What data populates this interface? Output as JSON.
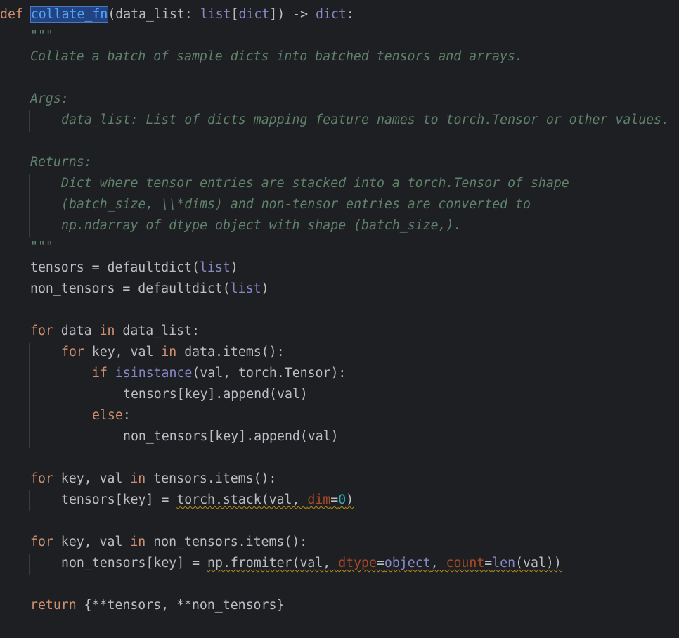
{
  "editor": {
    "language": "python",
    "code": {
      "def_keyword": "def",
      "function_name": "collate_fn",
      "signature_rest_1": "(data_list: ",
      "type_list": "list",
      "signature_bracket_open": "[",
      "type_dict": "dict",
      "signature_bracket_close": "]) -> ",
      "return_type": "dict",
      "signature_colon": ":",
      "docstring": {
        "open_quotes": "\"\"\"",
        "summary": "Collate a batch of sample dicts into batched tensors and arrays.",
        "args_header": "Args:",
        "args_line": "data_list: List of dicts mapping feature names to torch.Tensor or other values.",
        "returns_header": "Returns:",
        "returns_line_1": "Dict where tensor entries are stacked into a torch.Tensor of shape",
        "returns_line_2": "(batch_size, \\\\*dims) and non-tensor entries are converted to",
        "returns_line_3": "np.ndarray of dtype object with shape (batch_size,).",
        "close_quotes": "\"\"\""
      },
      "l_tensors_a": "tensors = defaultdict(",
      "l_tensors_b": "list",
      "l_tensors_c": ")",
      "l_nontensors_a": "non_tensors = defaultdict(",
      "l_nontensors_b": "list",
      "l_nontensors_c": ")",
      "kw_for": "for",
      "kw_in": "in",
      "kw_if": "if",
      "kw_else": "else",
      "kw_return": "return",
      "loop1_a": " data ",
      "loop1_b": " data_list:",
      "loop2_a": " key, val ",
      "loop2_b": " data.items():",
      "if_fn": "isinstance",
      "if_rest": "(val, torch.Tensor):",
      "append_tensor": "tensors[key].append(val)",
      "else_colon": ":",
      "append_nontensor": "non_tensors[key].append(val)",
      "loop3_a": " key, val ",
      "loop3_b": " tensors.items():",
      "stack_a": "tensors[key] = ",
      "stack_b": "torch.stack(val, ",
      "stack_param": "dim",
      "stack_eq": "=",
      "stack_num": "0",
      "stack_close": ")",
      "loop4_a": " key, val ",
      "loop4_b": " non_tensors.items():",
      "fromiter_a": "non_tensors[key] = ",
      "fromiter_b": "np.fromiter(val, ",
      "fromiter_p1": "dtype",
      "fromiter_eq1": "=",
      "fromiter_obj": "object",
      "fromiter_comma": ", ",
      "fromiter_p2": "count",
      "fromiter_eq2": "=",
      "fromiter_len": "len",
      "fromiter_end": "(val))",
      "return_rest": " {**tensors, **non_tensors}"
    },
    "colors": {
      "background": "#1e1f22",
      "keyword": "#cf8e6d",
      "function": "#56a8f5",
      "builtin": "#8888c6",
      "docstring": "#5f826b",
      "parameter": "#aa4926",
      "number": "#2aacb8",
      "text": "#bcbec4",
      "selection": "#214283",
      "warning_underline": "#b38d1d"
    }
  }
}
